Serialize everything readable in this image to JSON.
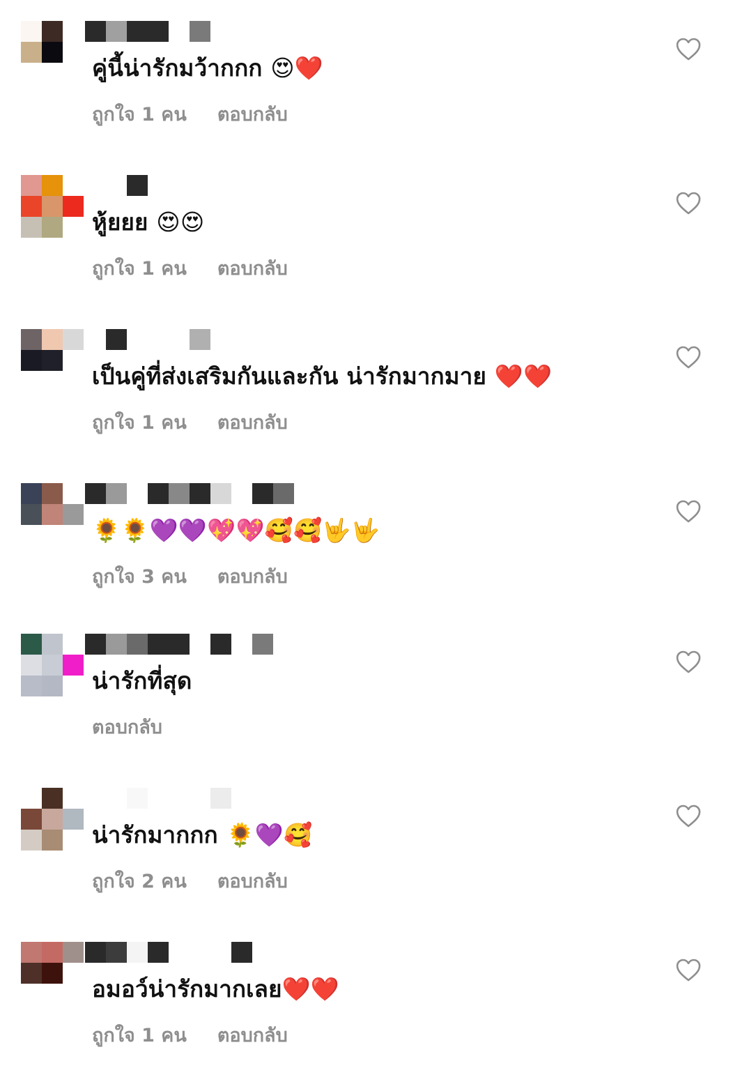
{
  "comments": [
    {
      "text": "คู่นี้น่ารักมว้ากกก 😍❤️",
      "likes_label": "ถูกใจ 1 คน",
      "reply_label": "ตอบกลับ",
      "avatar_colors": [
        "#fbf6f1",
        "#3e2a24",
        "#ffffff",
        "#c9b08a",
        "#0b0a10",
        "#ffffff",
        "#ffffff",
        "#ffffff",
        "#ffffff"
      ],
      "username_colors": [
        "#2a2a2a",
        "#a0a0a0",
        "#2a2a2a",
        "#2a2a2a",
        "#ffffff",
        "#7a7a7a"
      ]
    },
    {
      "text": "หู้ยยย 😍😍",
      "likes_label": "ถูกใจ 1 คน",
      "reply_label": "ตอบกลับ",
      "avatar_colors": [
        "#e09890",
        "#e6920a",
        "#ffffff",
        "#ea4528",
        "#d8966a",
        "#ec2a1e",
        "#c6c0b4",
        "#b0a880",
        "#ffffff"
      ],
      "username_colors": [
        "#ffffff",
        "#ffffff",
        "#2a2a2a"
      ]
    },
    {
      "text": "เป็นคู่ที่ส่งเสริมกันและกัน น่ารักมากมาย ❤️❤️",
      "likes_label": "ถูกใจ 1 คน",
      "reply_label": "ตอบกลับ",
      "avatar_colors": [
        "#6e6466",
        "#f0c8b0",
        "#d8d8d8",
        "#1a1a24",
        "#20202a",
        "#ffffff",
        "#ffffff",
        "#ffffff",
        "#ffffff"
      ],
      "username_colors": [
        "#ffffff",
        "#2a2a2a",
        "#ffffff",
        "#ffffff",
        "#ffffff",
        "#b0b0b0"
      ]
    },
    {
      "text": "🌻🌻💜💜💖💖🥰🥰🤟🤟",
      "likes_label": "ถูกใจ 3 คน",
      "reply_label": "ตอบกลับ",
      "avatar_colors": [
        "#3a4258",
        "#8a5a4a",
        "#ffffff",
        "#4a5058",
        "#c08478",
        "#9a9a9a",
        "#ffffff",
        "#ffffff",
        "#ffffff"
      ],
      "username_colors": [
        "#2a2a2a",
        "#9a9a9a",
        "#ffffff",
        "#2a2a2a",
        "#888888",
        "#2a2a2a",
        "#d8d8d8",
        "#ffffff",
        "#2a2a2a",
        "#6a6a6a"
      ]
    },
    {
      "text": "น่ารักที่สุด",
      "likes_label": "",
      "reply_label": "ตอบกลับ",
      "avatar_colors": [
        "#2c5a48",
        "#c0c4cc",
        "#ffffff",
        "#dcdee4",
        "#c8ccd4",
        "#f01ec8",
        "#b8bcc8",
        "#b4b8c4",
        "#ffffff"
      ],
      "username_colors": [
        "#2a2a2a",
        "#9a9a9a",
        "#6a6a6a",
        "#2a2a2a",
        "#2a2a2a",
        "#ffffff",
        "#2a2a2a",
        "#ffffff",
        "#7a7a7a"
      ]
    },
    {
      "text": "น่ารักมากกก 🌻💜🥰",
      "likes_label": "ถูกใจ 2 คน",
      "reply_label": "ตอบกลับ",
      "avatar_colors": [
        "#ffffff",
        "#4a3024",
        "#ffffff",
        "#7a4838",
        "#c8a89c",
        "#b0b8c0",
        "#d4ccc4",
        "#a88c74",
        "#ffffff"
      ],
      "username_colors": [
        "#ffffff",
        "#ffffff",
        "#f8f8f8",
        "#ffffff",
        "#ffffff",
        "#ffffff",
        "#ececec"
      ]
    },
    {
      "text": "อมอว์น่ารักมากเลย❤️❤️",
      "likes_label": "ถูกใจ 1 คน",
      "reply_label": "ตอบกลับ",
      "avatar_colors": [
        "#c07870",
        "#c46a64",
        "#a0908c",
        "#4e3028",
        "#3e120c",
        "#ffffff",
        "#ffffff",
        "#ffffff",
        "#ffffff"
      ],
      "username_colors": [
        "#2a2a2a",
        "#3c3c3c",
        "#f4f4f4",
        "#2a2a2a",
        "#ffffff",
        "#ffffff",
        "#ffffff",
        "#2a2a2a"
      ]
    }
  ],
  "icons": {
    "like": "heart-outline-icon"
  }
}
